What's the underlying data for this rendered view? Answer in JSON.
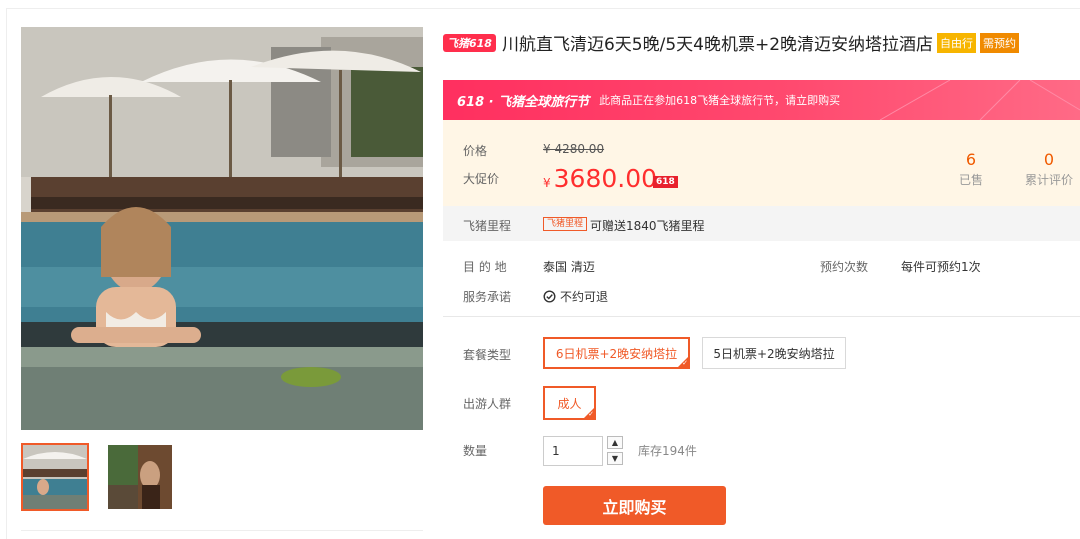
{
  "title": {
    "badge": "飞猪618",
    "text": "川航直飞清迈6天5晚/5天4晚机票+2晚清迈安纳塔拉酒店",
    "tags": [
      "自由行",
      "需预约"
    ]
  },
  "promo": {
    "title": "618 · 飞猪全球旅行节",
    "desc": "此商品正在参加618飞猪全球旅行节，请立即购买"
  },
  "price": {
    "label": "价格",
    "original": "¥ 4280.00",
    "promo_label": "大促价",
    "currency": "¥",
    "promo": "3680.00",
    "promo_tag": "618"
  },
  "stats": {
    "sold_value": "6",
    "sold_label": "已售",
    "reviews_value": "0",
    "reviews_label": "累计评价"
  },
  "miles": {
    "label": "飞猪里程",
    "tag": "飞猪里程",
    "text": "可赠送1840飞猪里程"
  },
  "info": {
    "dest_label": "目 的 地",
    "dest_value": "泰国  清迈",
    "booking_label": "预约次数",
    "booking_value": "每件可预约1次",
    "service_label": "服务承诺",
    "service_value": "不约可退"
  },
  "package": {
    "label": "套餐类型",
    "options": [
      "6日机票+2晚安纳塔拉",
      "5日机票+2晚安纳塔拉"
    ],
    "selected": 0
  },
  "traveler": {
    "label": "出游人群",
    "options": [
      "成人"
    ],
    "selected": 0
  },
  "quantity": {
    "label": "数量",
    "value": "1",
    "stock": "库存194件"
  },
  "buy_label": "立即购买",
  "colors": {
    "accent": "#f05a28",
    "price": "#ff2e2e",
    "promo_banner": "#ff2f5f"
  }
}
